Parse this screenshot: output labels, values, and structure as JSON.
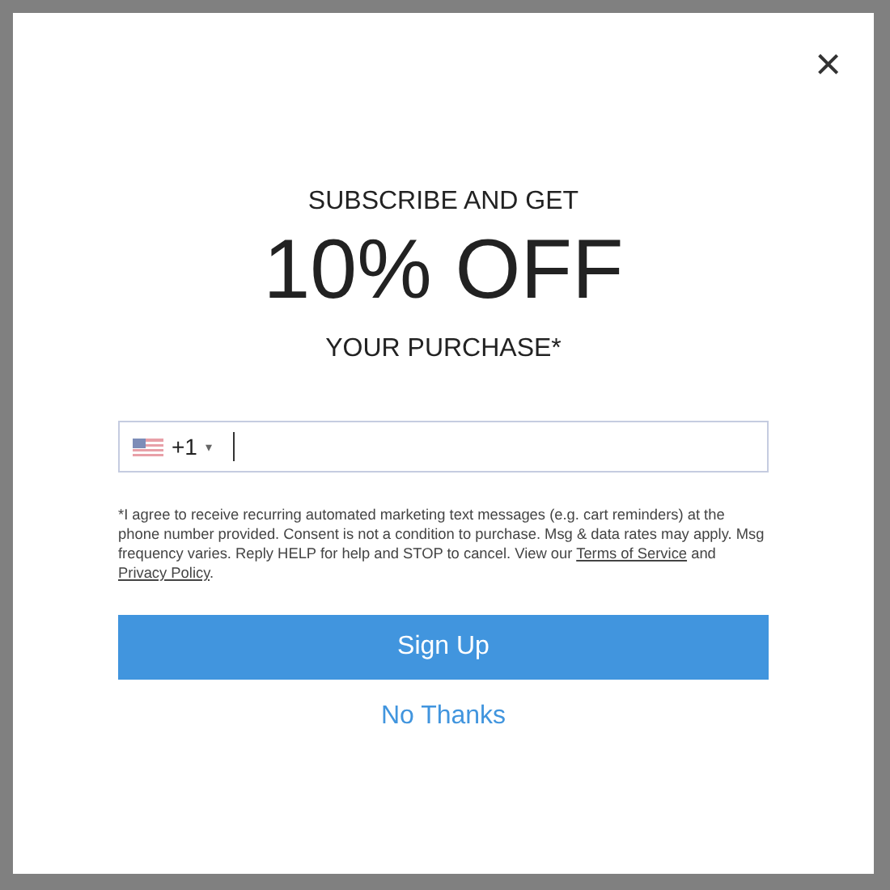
{
  "close": "×",
  "heading": {
    "top": "SUBSCRIBE AND GET",
    "offer": "10% OFF",
    "bottom": "YOUR PURCHASE*"
  },
  "phone": {
    "country_code": "+1",
    "caret": "▾"
  },
  "consent": {
    "text": "*I agree to receive recurring automated marketing text messages (e.g. cart reminders) at the phone number provided. Consent is not a condition to purchase. Msg & data rates may apply. Msg frequency varies. Reply HELP for help and STOP to cancel. View our",
    "terms_link": "Terms of Service",
    "joiner": "and",
    "privacy_link": "Privacy Policy",
    "end": "."
  },
  "buttons": {
    "primary": "Sign Up",
    "secondary": "No Thanks"
  }
}
